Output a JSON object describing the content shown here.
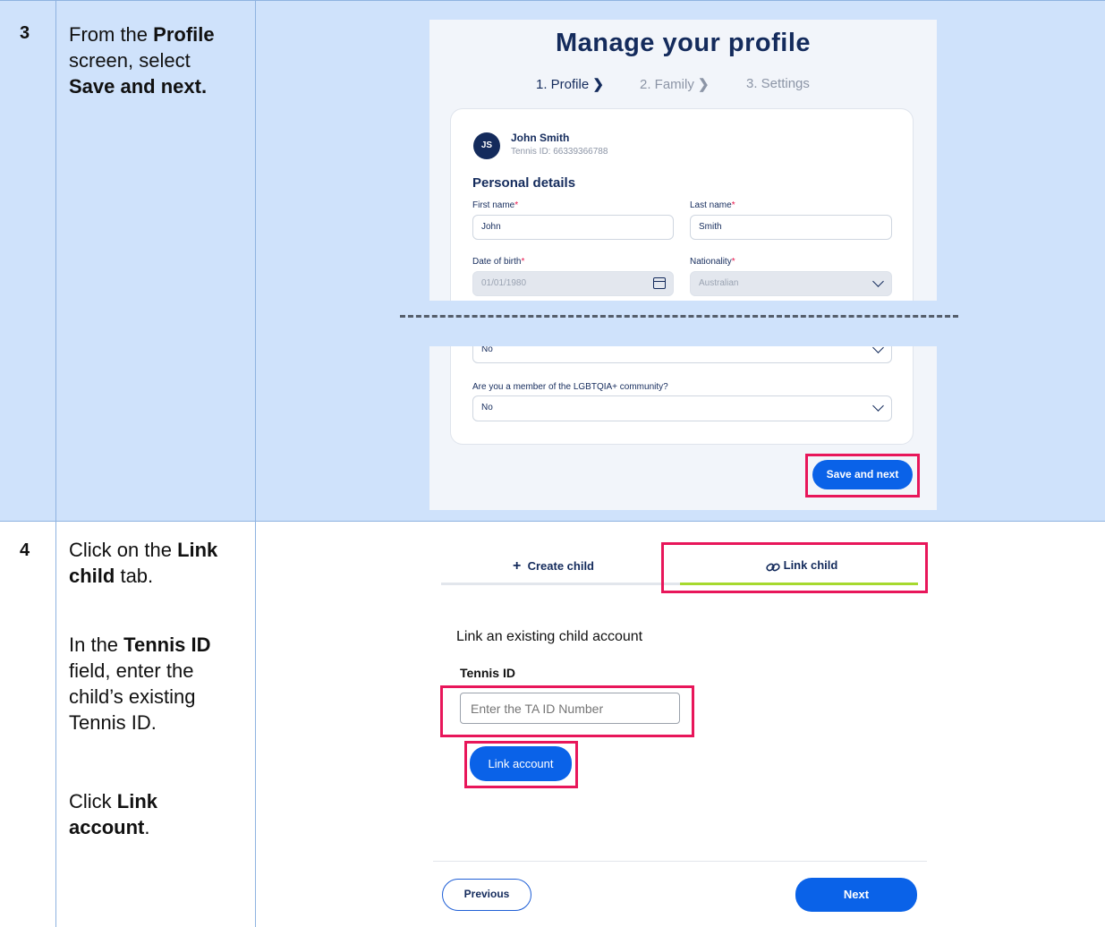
{
  "step3": {
    "number": "3",
    "instruction_parts": [
      "From the ",
      "Profile",
      " screen, select ",
      "Save and next."
    ],
    "screenshot": {
      "title": "Manage your profile",
      "steps": [
        {
          "label": "1. Profile"
        },
        {
          "label": "2. Family"
        },
        {
          "label": "3. Settings"
        }
      ],
      "step_chevron": "❯",
      "user": {
        "initials": "JS",
        "name": "John Smith",
        "tennis_id": "Tennis ID: 66339366788"
      },
      "section_title": "Personal details",
      "fields": {
        "first_name_label": "First name",
        "first_name_value": "John",
        "last_name_label": "Last name",
        "last_name_value": "Smith",
        "dob_label": "Date of birth",
        "dob_value": "01/01/1980",
        "nationality_label": "Nationality",
        "nationality_value": "Australian",
        "hidden_question_value": "No",
        "lgbt_label": "Are you a member of the LGBTQIA+ community?",
        "lgbt_value": "No"
      },
      "required_mark": "*",
      "save_button": "Save and next"
    }
  },
  "step4": {
    "number": "4",
    "instruction_p1": [
      "Click on the ",
      "Link child",
      " tab."
    ],
    "instruction_p2": [
      "In the ",
      "Tennis ID",
      " field, enter the child’s existing Tennis ID."
    ],
    "instruction_p3": [
      "Click ",
      "Link account",
      "."
    ],
    "screenshot": {
      "tabs": {
        "create_icon": "+",
        "create_label": "Create child",
        "link_icon": "🔗",
        "link_label": "Link child"
      },
      "section_title": "Link an existing child account",
      "tennis_id_label": "Tennis ID",
      "tennis_id_placeholder": "Enter the TA ID Number",
      "link_button": "Link account",
      "previous_button": "Previous",
      "next_button": "Next"
    }
  },
  "colors": {
    "row_bg": "#cfe2fb",
    "highlight": "#e8165a",
    "primary_button": "#0a62e8",
    "navy": "#142b5c",
    "active_tab": "#a6d92e"
  }
}
